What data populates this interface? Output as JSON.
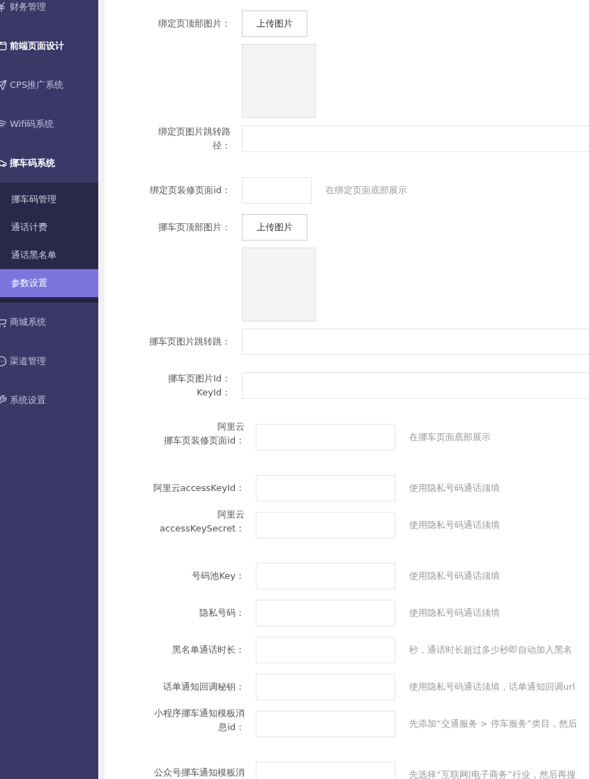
{
  "sidebar": {
    "items": [
      {
        "label": "财务管理",
        "active": false
      },
      {
        "label": "前端页面设计",
        "active": true
      },
      {
        "label": "CPS推广系统",
        "active": false
      },
      {
        "label": "Wifi码系统",
        "active": false
      },
      {
        "label": "挪车码系统",
        "active": true,
        "expanded": true,
        "children": [
          {
            "label": "挪车码管理",
            "selected": false
          },
          {
            "label": "通话计费",
            "selected": false
          },
          {
            "label": "通话黑名单",
            "selected": false
          },
          {
            "label": "参数设置",
            "selected": true
          }
        ]
      },
      {
        "label": "商城系统",
        "active": false
      },
      {
        "label": "渠道管理",
        "active": false
      },
      {
        "label": "系统设置",
        "active": false
      }
    ]
  },
  "form_top": [
    {
      "kind": "upload",
      "label": "绑定页顶部图片：",
      "button": "上传图片"
    },
    {
      "kind": "wide",
      "label": "绑定页图片跳转路径："
    },
    {
      "kind": "small",
      "label": "绑定页装修页面id：",
      "hint": "在绑定页面底部展示"
    },
    {
      "kind": "upload",
      "label": "挪车页顶部图片：",
      "button": "上传图片"
    },
    {
      "kind": "wide",
      "label": "挪车页图片跳转跳："
    },
    {
      "kind": "wide",
      "label": "挪车页图片Id：KeyId："
    }
  ],
  "form_bottom": [
    {
      "label_lines": [
        "阿里云",
        "挪车页装修页面id："
      ],
      "hint": "在挪车页面底部展示"
    },
    {
      "label_lines": [
        "阿里云accessKeyId："
      ],
      "hint": "使用隐私号码通话须填"
    },
    {
      "label_lines": [
        "阿里云",
        "accessKeySecret："
      ],
      "hint": "使用隐私号码通话须填"
    },
    {
      "label_lines": [
        "号码池Key："
      ],
      "hint": "使用隐私号码通话须填"
    },
    {
      "label_lines": [
        "隐私号码："
      ],
      "hint": "使用隐私号码通话须填"
    },
    {
      "label_lines": [
        "黑名单通话时长："
      ],
      "hint": "秒，通话时长超过多少秒即自动加入黑名"
    },
    {
      "label_lines": [
        "话单通知回调秘钥："
      ],
      "hint": "使用隐私号码通话须填，话单通知回调url"
    },
    {
      "label_lines": [
        "小程序挪车通知模板消",
        "息id："
      ],
      "hint": "先添加“交通服务 > 停车服务”类目，然后"
    },
    {
      "label_lines": [
        "公众号挪车通知模板消"
      ],
      "hint": "先选择“互联网|电子商务”行业，然后再搜"
    }
  ]
}
